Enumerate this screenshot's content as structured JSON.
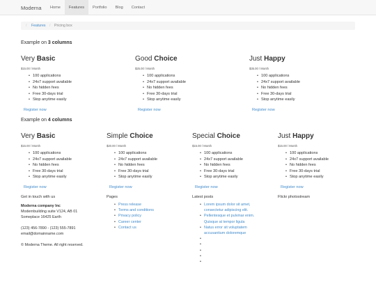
{
  "navbar": {
    "brand": "Moderna",
    "items": [
      "Home",
      "Features",
      "Portfolio",
      "Blog",
      "Contact"
    ],
    "active": "Features"
  },
  "breadcrumb": {
    "link": "Features",
    "current": "Pricing box"
  },
  "section3": {
    "prefix": "Example on ",
    "num": "3 columns"
  },
  "section4": {
    "prefix": "Example on ",
    "num": "4 columns"
  },
  "features": [
    "100 applications",
    "24x7 support available",
    "No hidden fees",
    "Free 30-days trial",
    "Stop anytime easily"
  ],
  "register_label": "Register now",
  "boxes3": [
    {
      "title_light": "Very ",
      "title_bold": "Basic",
      "price": "$15.00 / Month"
    },
    {
      "title_light": "Good ",
      "title_bold": "Choice",
      "price": "$25.00 / Month"
    },
    {
      "title_light": "Just ",
      "title_bold": "Happy",
      "price": "$35.00 / Month"
    }
  ],
  "boxes4": [
    {
      "title_light": "Very ",
      "title_bold": "Basic",
      "price": "$15.00 / Month"
    },
    {
      "title_light": "Simple ",
      "title_bold": "Choice",
      "price": "$20.00 / Month"
    },
    {
      "title_light": "Special ",
      "title_bold": "Choice",
      "price": "$15.00 / Month"
    },
    {
      "title_light": "Just ",
      "title_bold": "Happy",
      "price": "$15.00 / Month"
    }
  ],
  "footer": {
    "contact": {
      "heading": "Get in touch with us",
      "company": "Moderna company Inc",
      "address1": "Modernbuilding suite V124, AB 01",
      "address2": "Someplace 16425 Earth",
      "phone": "(123) 456-7890 - (123) 555-7891",
      "email": "email@domainname.com",
      "copyright": "© Moderna Theme. All right reserved."
    },
    "pages": {
      "heading": "Pages",
      "links": [
        "Press release",
        "Terms and conditions",
        "Privacy policy",
        "Career center",
        "Contact us"
      ]
    },
    "posts": {
      "heading": "Latest posts",
      "links": [
        "Lorem ipsum dolor sit amet, consectetur adipiscing elit.",
        "Pellentesque et pulvinar enim. Quisque at tempor ligula",
        "Natus error sit voluptatem accusantium doloremque"
      ]
    },
    "flickr": {
      "heading": "Flickr photostream"
    }
  }
}
